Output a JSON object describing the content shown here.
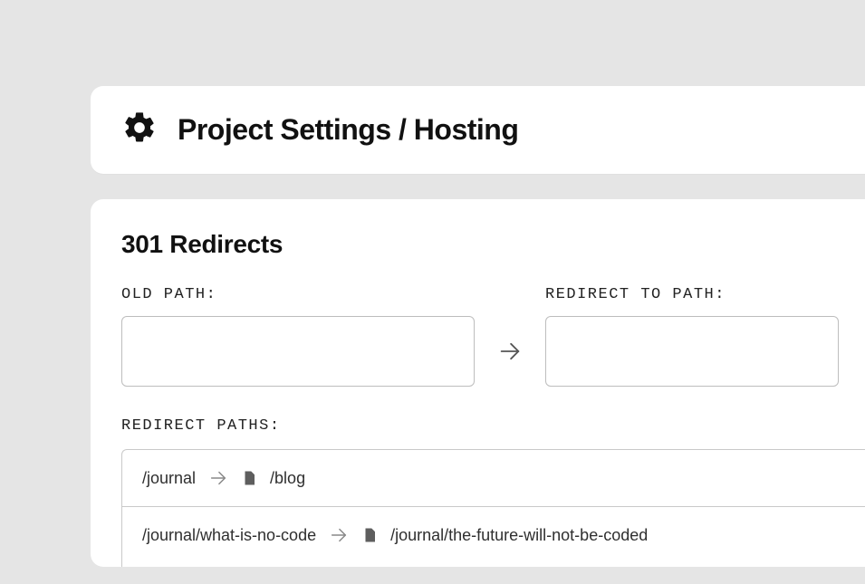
{
  "header": {
    "title": "Project Settings / Hosting"
  },
  "redirects": {
    "section_title": "301 Redirects",
    "old_path_label": "OLD PATH:",
    "redirect_to_label": "REDIRECT TO PATH:",
    "old_path_value": "",
    "redirect_to_value": "",
    "list_label": "REDIRECT PATHS:",
    "rows": [
      {
        "from": "/journal",
        "to": "/blog"
      },
      {
        "from": "/journal/what-is-no-code",
        "to": "/journal/the-future-will-not-be-coded"
      }
    ]
  }
}
